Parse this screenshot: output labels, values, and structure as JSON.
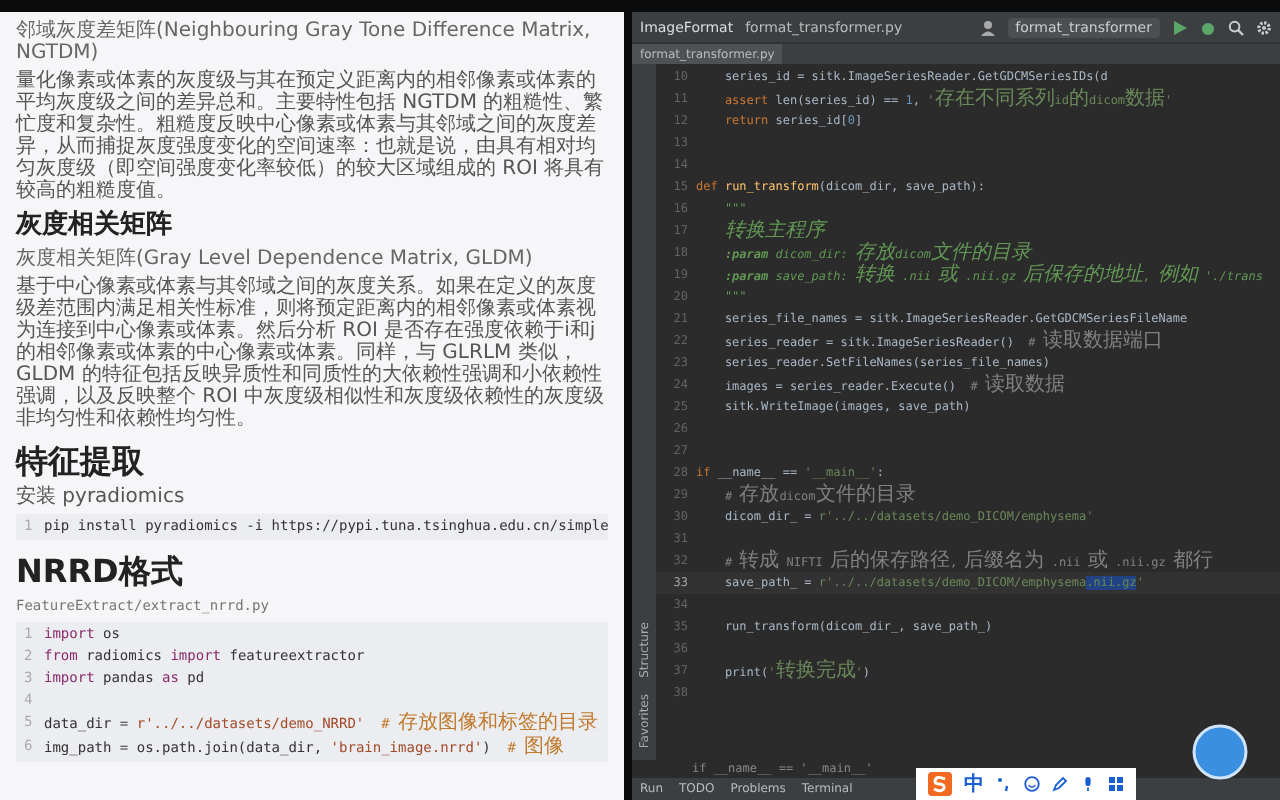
{
  "document": {
    "blocks": [
      {
        "kind": "caption",
        "text": "邻域灰度差矩阵(Neighbouring Gray Tone Difference Matrix, NGTDM)"
      },
      {
        "kind": "paragraph",
        "text": "量化像素或体素的灰度级与其在预定义距离内的相邻像素或体素的平均灰度级之间的差异总和。主要特性包括 NGTDM 的粗糙性、繁忙度和复杂性。粗糙度反映中心像素或体素与其邻域之间的灰度差异，从而捕捉灰度强度变化的空间速率：也就是说，由具有相对均匀灰度级（即空间强度变化率较低）的较大区域组成的 ROI 将具有较高的粗糙度值。"
      },
      {
        "kind": "heading2",
        "text": "灰度相关矩阵"
      },
      {
        "kind": "caption",
        "text": "灰度相关矩阵(Gray Level Dependence Matrix, GLDM)"
      },
      {
        "kind": "paragraph",
        "text": "基于中心像素或体素与其邻域之间的灰度关系。如果在定义的灰度级差范围内满足相关性标准，则将预定距离内的相邻像素或体素视为连接到中心像素或体素。然后分析 ROI 是否存在强度依赖于i和j的相邻像素或体素的中心像素或体素。同样，与 GLRLM 类似，GLDM 的特征包括反映异质性和同质性的大依赖性强调和小依赖性强调，以及反映整个 ROI 中灰度级相似性和灰度级依赖性的灰度级非均匀性和依赖性均匀性。"
      },
      {
        "kind": "heading1",
        "text": "特征提取"
      },
      {
        "kind": "paragraph",
        "text": "安装 pyradiomics"
      },
      {
        "kind": "code",
        "lines": [
          {
            "number": "1",
            "segments": [
              {
                "kind": "plain",
                "text": "pip install pyradiomics -i https://pypi.tuna.tsinghua.edu.cn/simple"
              }
            ]
          }
        ]
      },
      {
        "kind": "heading1",
        "text": "NRRD格式"
      },
      {
        "kind": "filename",
        "text": "FeatureExtract/extract_nrrd.py"
      },
      {
        "kind": "code",
        "lines": [
          {
            "number": "1",
            "segments": [
              {
                "kind": "keyword",
                "text": "import"
              },
              {
                "kind": "plain",
                "text": " os"
              }
            ]
          },
          {
            "number": "2",
            "segments": [
              {
                "kind": "keyword",
                "text": "from"
              },
              {
                "kind": "plain",
                "text": " radiomics "
              },
              {
                "kind": "keyword",
                "text": "import"
              },
              {
                "kind": "plain",
                "text": " featureextractor"
              }
            ]
          },
          {
            "number": "3",
            "segments": [
              {
                "kind": "keyword",
                "text": "import"
              },
              {
                "kind": "plain",
                "text": " pandas "
              },
              {
                "kind": "keyword",
                "text": "as"
              },
              {
                "kind": "plain",
                "text": " pd"
              }
            ]
          },
          {
            "number": "4"
          },
          {
            "number": "5",
            "segments": [
              {
                "kind": "plain",
                "text": "data_dir = "
              },
              {
                "kind": "string",
                "text": "r'../../datasets/demo_NRRD'"
              },
              {
                "kind": "comment",
                "text": "  # 存放图像和标签的目录"
              }
            ]
          },
          {
            "number": "6",
            "segments": [
              {
                "kind": "plain",
                "text": "img_path = os.path.join(data_dir, "
              },
              {
                "kind": "string",
                "text": "'brain_image.nrrd'"
              },
              {
                "kind": "plain",
                "text": ")"
              },
              {
                "kind": "comment",
                "text": "  # 图像"
              }
            ]
          }
        ]
      }
    ]
  },
  "ide": {
    "project": "ImageFormat",
    "file_tab": "format_transformer.py",
    "run_config": "format_transformer",
    "editor_tab": "format_transformer.py",
    "side_tabs": [
      "Structure",
      "Favorites"
    ],
    "lines": [
      {
        "number": "10",
        "current": false,
        "segments": [
          {
            "kind": "plain",
            "text": "    series_id = sitk.ImageSeriesReader.GetGDCMSeriesIDs(d"
          }
        ]
      },
      {
        "number": "11",
        "current": false,
        "segments": [
          {
            "kind": "keyword",
            "text": "    assert"
          },
          {
            "kind": "plain",
            "text": " len(series_id) == "
          },
          {
            "kind": "number",
            "text": "1"
          },
          {
            "kind": "plain",
            "text": ", "
          },
          {
            "kind": "string",
            "text": "'存在不同系列id的dicom数据'"
          }
        ]
      },
      {
        "number": "12",
        "current": false,
        "segments": [
          {
            "kind": "keyword",
            "text": "    return"
          },
          {
            "kind": "plain",
            "text": " series_id["
          },
          {
            "kind": "number",
            "text": "0"
          },
          {
            "kind": "plain",
            "text": "]"
          }
        ]
      },
      {
        "number": "13",
        "current": false
      },
      {
        "number": "14",
        "current": false
      },
      {
        "number": "15",
        "current": false,
        "segments": [
          {
            "kind": "keyword",
            "text": "def "
          },
          {
            "kind": "function",
            "text": "run_transform"
          },
          {
            "kind": "plain",
            "text": "(dicom_dir, save_path):"
          }
        ]
      },
      {
        "number": "16",
        "current": false,
        "segments": [
          {
            "kind": "docstring",
            "text": "    \"\"\""
          }
        ]
      },
      {
        "number": "17",
        "current": false,
        "segments": [
          {
            "kind": "docstring",
            "text": "    转换主程序"
          }
        ]
      },
      {
        "number": "18",
        "current": false,
        "segments": [
          {
            "kind": "doctag",
            "text": "    :param"
          },
          {
            "kind": "docstring",
            "text": " dicom_dir: 存放dicom文件的目录"
          }
        ]
      },
      {
        "number": "19",
        "current": false,
        "segments": [
          {
            "kind": "doctag",
            "text": "    :param"
          },
          {
            "kind": "docstring",
            "text": " save_path: 转换 .nii 或 .nii.gz 后保存的地址, 例如 './trans"
          }
        ]
      },
      {
        "number": "20",
        "current": false,
        "segments": [
          {
            "kind": "docstring",
            "text": "    \"\"\""
          }
        ]
      },
      {
        "number": "21",
        "current": false,
        "segments": [
          {
            "kind": "plain",
            "text": "    series_file_names = sitk.ImageSeriesReader.GetGDCMSeriesFileName"
          }
        ]
      },
      {
        "number": "22",
        "current": false,
        "segments": [
          {
            "kind": "plain",
            "text": "    series_reader = sitk.ImageSeriesReader()  "
          },
          {
            "kind": "comment",
            "text": "# 读取数据端口"
          }
        ]
      },
      {
        "number": "23",
        "current": false,
        "segments": [
          {
            "kind": "plain",
            "text": "    series_reader.SetFileNames(series_file_names)"
          }
        ]
      },
      {
        "number": "24",
        "current": false,
        "segments": [
          {
            "kind": "plain",
            "text": "    images = series_reader.Execute()  "
          },
          {
            "kind": "comment",
            "text": "# 读取数据"
          }
        ]
      },
      {
        "number": "25",
        "current": false,
        "segments": [
          {
            "kind": "plain",
            "text": "    sitk.WriteImage(images, save_path)"
          }
        ]
      },
      {
        "number": "26",
        "current": false
      },
      {
        "number": "27",
        "current": false
      },
      {
        "number": "28",
        "current": false,
        "segments": [
          {
            "kind": "keyword",
            "text": "if"
          },
          {
            "kind": "plain",
            "text": " __name__ == "
          },
          {
            "kind": "string",
            "text": "'__main__'"
          },
          {
            "kind": "plain",
            "text": ":"
          }
        ]
      },
      {
        "number": "29",
        "current": false,
        "segments": [
          {
            "kind": "comment",
            "text": "    # 存放dicom文件的目录"
          }
        ]
      },
      {
        "number": "30",
        "current": false,
        "segments": [
          {
            "kind": "plain",
            "text": "    dicom_dir_ = "
          },
          {
            "kind": "string",
            "text": "r'../../datasets/demo_DICOM/emphysema'"
          }
        ]
      },
      {
        "number": "31",
        "current": false
      },
      {
        "number": "32",
        "current": false,
        "segments": [
          {
            "kind": "comment",
            "text": "    # 转成 NIFTI 后的保存路径, 后缀名为 .nii 或 .nii.gz 都行"
          }
        ]
      },
      {
        "number": "33",
        "current": true,
        "segments": [
          {
            "kind": "plain",
            "text": "    save_path_ = "
          },
          {
            "kind": "string",
            "text": "r'../../datasets/demo_DICOM/emphysema"
          },
          {
            "kind": "selected",
            "text": ".nii.gz"
          },
          {
            "kind": "string",
            "text": "'"
          }
        ]
      },
      {
        "number": "34",
        "current": false
      },
      {
        "number": "35",
        "current": false,
        "segments": [
          {
            "kind": "plain",
            "text": "    run_transform(dicom_dir_, save_path_)"
          }
        ]
      },
      {
        "number": "36",
        "current": false
      },
      {
        "number": "37",
        "current": false,
        "segments": [
          {
            "kind": "plain",
            "text": "    print("
          },
          {
            "kind": "string",
            "text": "'转换完成'"
          },
          {
            "kind": "plain",
            "text": ")"
          }
        ]
      },
      {
        "number": "38",
        "current": false
      }
    ],
    "breadcrumb": "if __name__ == '__main__'",
    "tool_windows": [
      "Run",
      "TODO",
      "Problems",
      "Terminal"
    ],
    "ime": {
      "mode": "中"
    }
  }
}
